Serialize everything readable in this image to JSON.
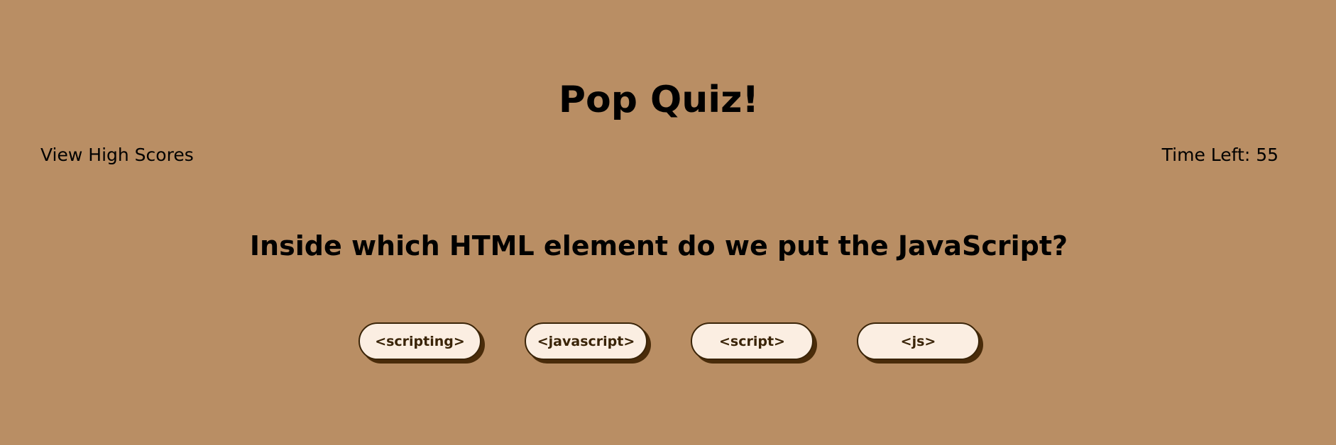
{
  "header": {
    "title": "Pop Quiz!",
    "high_scores_link": "View High Scores",
    "timer_label": "Time Left: 55"
  },
  "quiz": {
    "question": "Inside which HTML element do we put the JavaScript?",
    "choices": [
      "<scripting>",
      "<javascript>",
      "<script>",
      "<js>"
    ]
  },
  "colors": {
    "background": "#b98e64",
    "button_fill": "#fbeee2",
    "button_border": "#3a2408",
    "button_shadow": "#4a2c0a"
  }
}
